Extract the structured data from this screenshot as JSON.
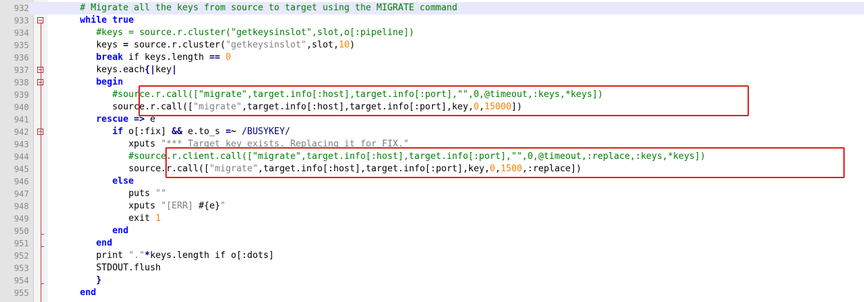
{
  "editor": {
    "current_line": 932,
    "highlight_boxes": [
      {
        "from_line": 939,
        "to_line": 940
      },
      {
        "from_line": 944,
        "to_line": 945
      }
    ],
    "fold_markers": [
      933,
      937,
      938,
      942
    ],
    "lines": [
      {
        "num": "932",
        "indent": 6,
        "tokens": [
          [
            "cm",
            "# Migrate all the keys from source to target using the MIGRATE command"
          ]
        ]
      },
      {
        "num": "933",
        "indent": 6,
        "tokens": [
          [
            "kw",
            "while"
          ],
          [
            "id",
            " "
          ],
          [
            "kw",
            "true"
          ]
        ]
      },
      {
        "num": "934",
        "indent": 9,
        "tokens": [
          [
            "cm",
            "#keys = source.r.cluster(\"getkeysinslot\",slot,o[:pipeline])"
          ]
        ]
      },
      {
        "num": "935",
        "indent": 9,
        "tokens": [
          [
            "id",
            "keys "
          ],
          [
            "op",
            "="
          ],
          [
            "id",
            " source.r.cluster("
          ],
          [
            "st",
            "\"getkeysinslot\""
          ],
          [
            "id",
            ",slot,"
          ],
          [
            "nm",
            "10"
          ],
          [
            "id",
            ")"
          ]
        ]
      },
      {
        "num": "936",
        "indent": 9,
        "tokens": [
          [
            "kw",
            "break"
          ],
          [
            "id",
            " if keys.length "
          ],
          [
            "op",
            "=="
          ],
          [
            "id",
            " "
          ],
          [
            "nm",
            "0"
          ]
        ]
      },
      {
        "num": "937",
        "indent": 9,
        "tokens": [
          [
            "id",
            "keys.each"
          ],
          [
            "op",
            "{|"
          ],
          [
            "id",
            "key"
          ],
          [
            "op",
            "|"
          ]
        ]
      },
      {
        "num": "938",
        "indent": 9,
        "tokens": [
          [
            "kw",
            "begin"
          ]
        ]
      },
      {
        "num": "939",
        "indent": 12,
        "tokens": [
          [
            "cm",
            "#source.r.call([\"migrate\",target.info[:host],target.info[:port],\"\",0,@timeout,:keys,*keys])"
          ]
        ]
      },
      {
        "num": "940",
        "indent": 12,
        "tokens": [
          [
            "id",
            "source.r.call(["
          ],
          [
            "st",
            "\"migrate\""
          ],
          [
            "id",
            ",target.info[:host],target.info[:port],key,"
          ],
          [
            "nm",
            "0"
          ],
          [
            "id",
            ","
          ],
          [
            "nm",
            "15000"
          ],
          [
            "id",
            "])"
          ]
        ]
      },
      {
        "num": "941",
        "indent": 9,
        "tokens": [
          [
            "kw",
            "rescue"
          ],
          [
            "id",
            " "
          ],
          [
            "op",
            "=>"
          ],
          [
            "id",
            " e"
          ]
        ]
      },
      {
        "num": "942",
        "indent": 12,
        "tokens": [
          [
            "kw",
            "if"
          ],
          [
            "id",
            " o[:fix] "
          ],
          [
            "op",
            "&&"
          ],
          [
            "id",
            " e.to_s "
          ],
          [
            "op",
            "=~"
          ],
          [
            "id",
            " "
          ],
          [
            "rx",
            "/BUSYKEY/"
          ]
        ]
      },
      {
        "num": "943",
        "indent": 15,
        "tokens": [
          [
            "id",
            "xputs "
          ],
          [
            "st",
            "\"*** Target key exists. Replacing it for FIX.\""
          ]
        ]
      },
      {
        "num": "944",
        "indent": 15,
        "tokens": [
          [
            "cm",
            "#source.r.client.call([\"migrate\",target.info[:host],target.info[:port],\"\",0,@timeout,:replace,:keys,*keys])"
          ]
        ]
      },
      {
        "num": "945",
        "indent": 15,
        "tokens": [
          [
            "id",
            "source.r.call(["
          ],
          [
            "st",
            "\"migrate\""
          ],
          [
            "id",
            ",target.info[:host],target.info[:port],key,"
          ],
          [
            "nm",
            "0"
          ],
          [
            "id",
            ","
          ],
          [
            "nm",
            "1500"
          ],
          [
            "id",
            ",:replace])"
          ]
        ]
      },
      {
        "num": "946",
        "indent": 12,
        "tokens": [
          [
            "kw",
            "else"
          ]
        ]
      },
      {
        "num": "947",
        "indent": 15,
        "tokens": [
          [
            "id",
            "puts "
          ],
          [
            "st",
            "\"\""
          ]
        ]
      },
      {
        "num": "948",
        "indent": 15,
        "tokens": [
          [
            "id",
            "xputs "
          ],
          [
            "st",
            "\"[ERR] "
          ],
          [
            "id",
            "#{e}"
          ],
          [
            "st",
            "\""
          ]
        ]
      },
      {
        "num": "949",
        "indent": 15,
        "tokens": [
          [
            "id",
            "exit "
          ],
          [
            "nm",
            "1"
          ]
        ]
      },
      {
        "num": "950",
        "indent": 12,
        "tokens": [
          [
            "kw",
            "end"
          ]
        ]
      },
      {
        "num": "951",
        "indent": 9,
        "tokens": [
          [
            "kw",
            "end"
          ]
        ]
      },
      {
        "num": "952",
        "indent": 9,
        "tokens": [
          [
            "id",
            "print "
          ],
          [
            "st",
            "\".\""
          ],
          [
            "op",
            "*"
          ],
          [
            "id",
            "keys.length if o[:dots]"
          ]
        ]
      },
      {
        "num": "953",
        "indent": 9,
        "tokens": [
          [
            "id",
            "STDOUT.flush"
          ]
        ]
      },
      {
        "num": "954",
        "indent": 9,
        "tokens": [
          [
            "op",
            "}"
          ]
        ]
      },
      {
        "num": "955",
        "indent": 6,
        "tokens": [
          [
            "kw",
            "end"
          ]
        ]
      }
    ]
  }
}
